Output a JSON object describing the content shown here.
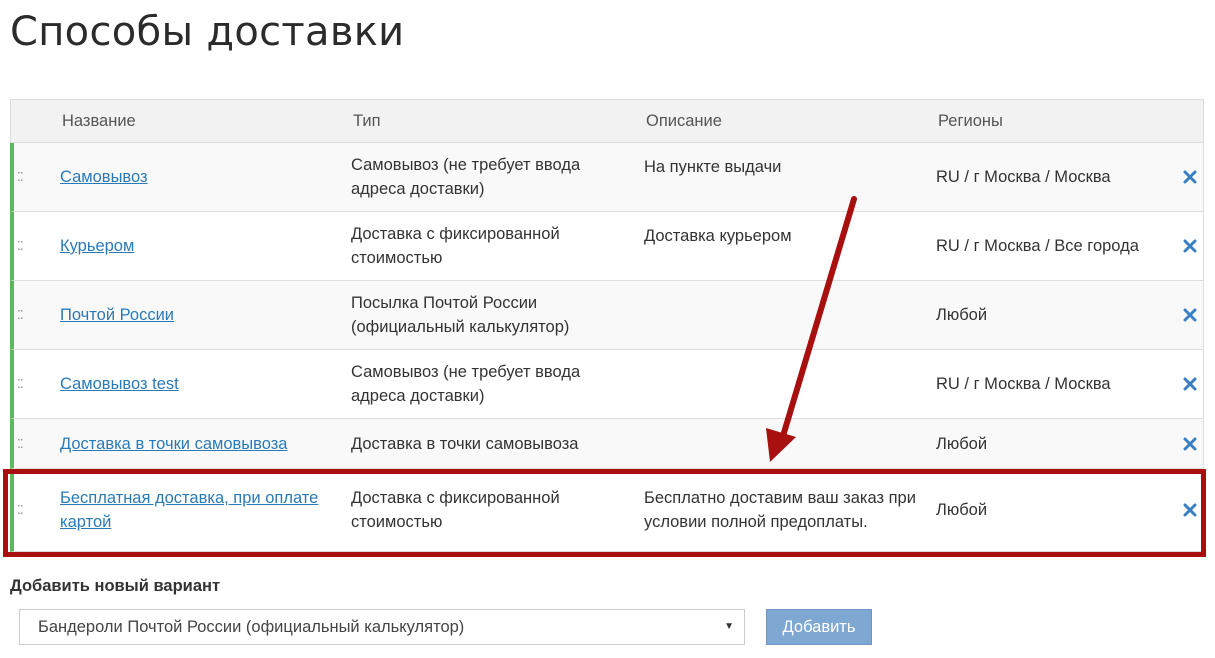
{
  "page": {
    "title": "Способы доставки"
  },
  "table": {
    "headers": {
      "name": "Название",
      "type": "Тип",
      "description": "Описание",
      "regions": "Регионы"
    },
    "rows": [
      {
        "name": "Самовывоз",
        "type": "Самовывоз (не требует ввода адреса доставки)",
        "description": "На пункте выдачи",
        "regions": "RU / г Москва / Москва"
      },
      {
        "name": "Курьером",
        "type": "Доставка с фиксированной стоимостью",
        "description": "Доставка курьером",
        "regions": "RU / г Москва / Все города"
      },
      {
        "name": "Почтой России",
        "type": "Посылка Почтой России (официальный калькулятор)",
        "description": "",
        "regions": "Любой"
      },
      {
        "name": "Самовывоз test",
        "type": "Самовывоз (не требует ввода адреса доставки)",
        "description": "",
        "regions": "RU / г Москва / Москва"
      },
      {
        "name": "Доставка в точки самовывоза",
        "type": "Доставка в точки самовывоза",
        "description": "",
        "regions": "Любой"
      },
      {
        "name": "Бесплатная доставка, при оплате картой",
        "type": "Доставка с фиксированной стоимостью",
        "description": "Бесплатно доставим ваш заказ при условии полной предоплаты.",
        "regions": "Любой"
      }
    ]
  },
  "add_section": {
    "title": "Добавить новый вариант",
    "select_value": "Бандероли Почтой России (официальный калькулятор)",
    "button_label": "Добавить"
  },
  "icons": {
    "drag": "drag-handle-icon",
    "delete": "close-icon",
    "caret": "caret-down-icon"
  },
  "colors": {
    "link": "#2a7ab8",
    "row_accent": "#5cb85c",
    "delete_icon": "#3a7fc1",
    "highlight": "#a80f0f",
    "button": "#7ea7d2"
  }
}
